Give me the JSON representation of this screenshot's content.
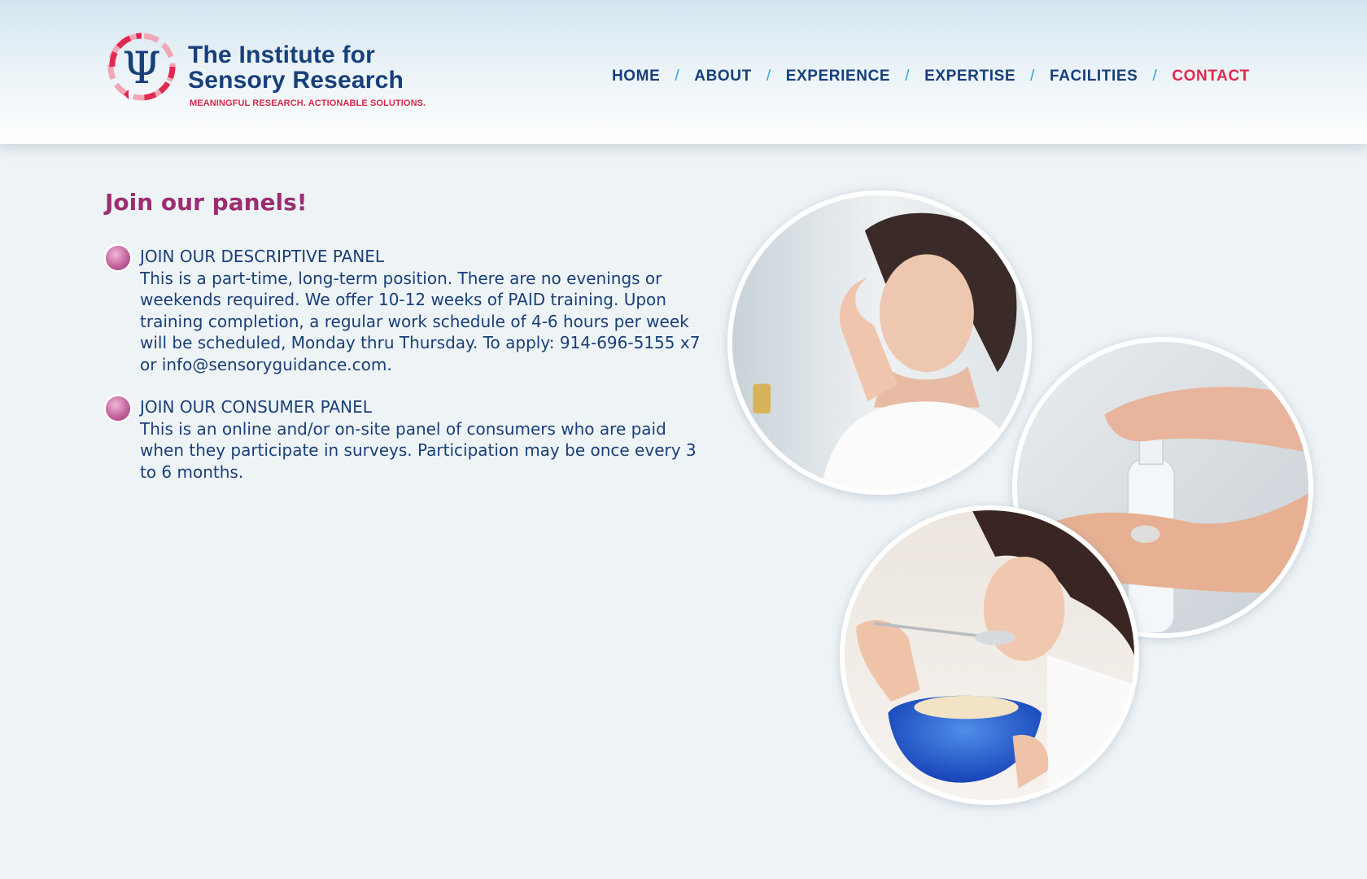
{
  "header": {
    "logo": {
      "symbol": "Ψ",
      "title_line1": "The Institute for",
      "title_line2": "Sensory Research",
      "tagline": "MEANINGFUL RESEARCH. ACTIONABLE SOLUTIONS."
    },
    "nav": {
      "items": [
        {
          "label": "HOME"
        },
        {
          "label": "ABOUT"
        },
        {
          "label": "EXPERIENCE"
        },
        {
          "label": "EXPERTISE"
        },
        {
          "label": "FACILITIES"
        },
        {
          "label": "CONTACT",
          "active": true
        }
      ],
      "separator": "/"
    }
  },
  "main": {
    "title": "Join our panels!",
    "panels": [
      {
        "title": "JOIN OUR DESCRIPTIVE PANEL",
        "body": "This is a part-time, long-term position. There are no evenings or weekends required. We offer 10-12 weeks of PAID training. Upon training completion, a regular work schedule of 4-6 hours per week will be scheduled, Monday thru Thursday. To apply: 914-696-5155 x7 or info@sensoryguidance.com."
      },
      {
        "title": "JOIN OUR CONSUMER PANEL",
        "body": "This is an online and/or on-site panel of consumers who are paid when they participate in surveys. Participation may be once every 3 to 6 months."
      }
    ]
  },
  "colors": {
    "brand_navy": "#173f7a",
    "brand_red": "#e0294e",
    "heading_magenta": "#9b2d72",
    "nav_separator": "#2ba3d8",
    "body_text": "#1a3f78"
  }
}
